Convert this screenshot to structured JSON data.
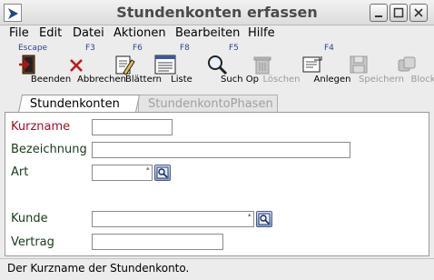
{
  "window": {
    "title": "Stundenkonten erfassen"
  },
  "menu": [
    "File",
    "Edit",
    "Datei",
    "Aktionen",
    "Bearbeiten",
    "Hilfe"
  ],
  "toolbar": {
    "beenden": {
      "key": "Escape",
      "label": "Beenden"
    },
    "abbrechen": {
      "key": "F3",
      "label": "Abbrechen"
    },
    "blaettern": {
      "key": "F6",
      "label": "Blättern"
    },
    "liste": {
      "key": "F8",
      "label": "Liste"
    },
    "such_op": {
      "key": "F5",
      "label": "Such Op"
    },
    "loeschen": {
      "key": "",
      "label": "Löschen"
    },
    "anlegen": {
      "key": "F4",
      "label": "Anlegen"
    },
    "speichern": {
      "key": "",
      "label": "Speichern"
    },
    "block": {
      "key": "",
      "label": "Block"
    }
  },
  "tabs": {
    "active": "Stundenkonten",
    "inactive": "StundenkontoPhasen"
  },
  "form": {
    "kurzname": {
      "label": "Kurzname",
      "value": ""
    },
    "bezeichnung": {
      "label": "Bezeichnung",
      "value": ""
    },
    "art": {
      "label": "Art",
      "value": ""
    },
    "kunde": {
      "label": "Kunde",
      "value": ""
    },
    "vertrag": {
      "label": "Vertrag",
      "value": ""
    }
  },
  "status": {
    "text": "Der Kurzname der Stundenkonto."
  },
  "colors": {
    "required_label": "#a0102a",
    "label": "#1a3a1a",
    "accent": "#2a4a8a"
  }
}
